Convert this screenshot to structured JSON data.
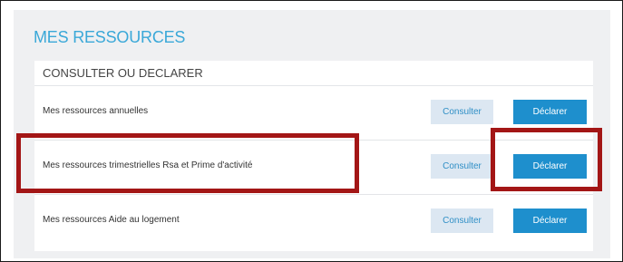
{
  "section": {
    "title": "MES RESSOURCES",
    "subtitle": "CONSULTER OU DECLARER"
  },
  "rows": [
    {
      "label": "Mes ressources annuelles",
      "consult_label": "Consulter",
      "declare_label": "Déclarer"
    },
    {
      "label": "Mes ressources trimestrielles Rsa et Prime d'activité",
      "consult_label": "Consulter",
      "declare_label": "Déclarer"
    },
    {
      "label": "Mes ressources Aide au logement",
      "consult_label": "Consulter",
      "declare_label": "Déclarer"
    }
  ],
  "colors": {
    "title": "#3aa8d8",
    "consult_button_bg": "#dce7f2",
    "declare_button_bg": "#1e8fcd",
    "highlight_border": "#a31616"
  }
}
